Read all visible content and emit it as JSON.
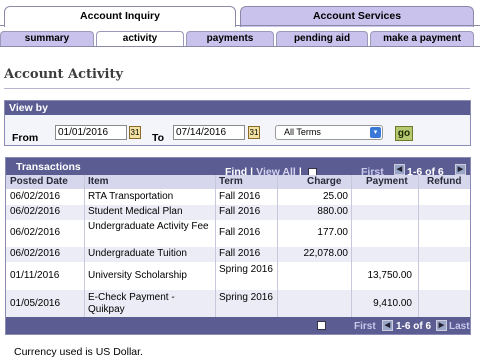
{
  "top_tabs": [
    {
      "label": "Account Inquiry",
      "active": true
    },
    {
      "label": "Account Services",
      "active": false
    }
  ],
  "sub_tabs": [
    {
      "label": "summary",
      "active": false
    },
    {
      "label": "activity",
      "active": true
    },
    {
      "label": "payments",
      "active": false
    },
    {
      "label": "pending aid",
      "active": false
    },
    {
      "label": "make a payment",
      "active": false
    }
  ],
  "page_title": "Account Activity",
  "view_by": {
    "heading": "View by",
    "from_label": "From",
    "from_value": "01/01/2016",
    "to_label": "To",
    "to_value": "07/14/2016",
    "term_selected": "All Terms",
    "go_label": "go"
  },
  "grid": {
    "title": "Transactions",
    "find_label": "Find",
    "view_all_label": "View All",
    "first_label": "First",
    "last_label": "Last",
    "count_label": "1-6 of 6",
    "columns": [
      "Posted Date",
      "Item",
      "Term",
      "Charge",
      "Payment",
      "Refund"
    ],
    "rows": [
      {
        "date": "06/02/2016",
        "item": "RTA Transportation",
        "term": "Fall 2016",
        "charge": "25.00",
        "payment": "",
        "refund": ""
      },
      {
        "date": "06/02/2016",
        "item": "Student Medical Plan",
        "term": "Fall 2016",
        "charge": "880.00",
        "payment": "",
        "refund": ""
      },
      {
        "date": "06/02/2016",
        "item": "Undergraduate Activity Fee",
        "term": "Fall 2016",
        "charge": "177.00",
        "payment": "",
        "refund": ""
      },
      {
        "date": "06/02/2016",
        "item": "Undergraduate Tuition",
        "term": "Fall 2016",
        "charge": "22,078.00",
        "payment": "",
        "refund": ""
      },
      {
        "date": "01/11/2016",
        "item": "University Scholarship",
        "term": "Spring 2016",
        "charge": "",
        "payment": "13,750.00",
        "refund": ""
      },
      {
        "date": "01/05/2016",
        "item": "E-Check Payment - Quikpay",
        "term": "Spring 2016",
        "charge": "",
        "payment": "9,410.00",
        "refund": ""
      }
    ]
  },
  "currency_note": "Currency used is US Dollar.",
  "colors": {
    "header_bar": "#5a5c92",
    "tab_inactive": "#c9c2ec",
    "column_head": "#d6d6ec",
    "go_button": "#b7c970"
  }
}
